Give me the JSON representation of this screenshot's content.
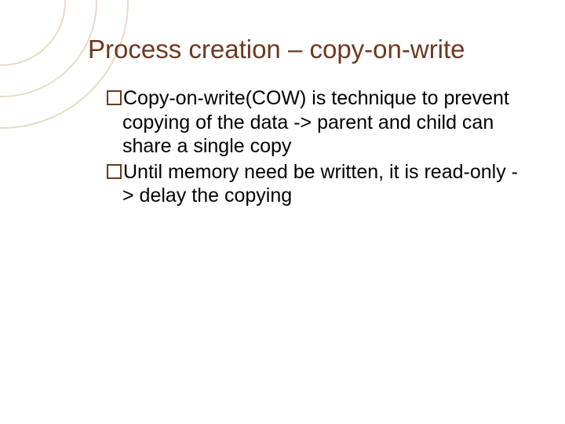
{
  "slide": {
    "title": "Process creation – copy-on-write",
    "bullets": [
      "Copy-on-write(COW) is technique to prevent copying of the data -> parent and child can share a single copy",
      "Until memory need be written, it is read-only -> delay the copying"
    ]
  }
}
